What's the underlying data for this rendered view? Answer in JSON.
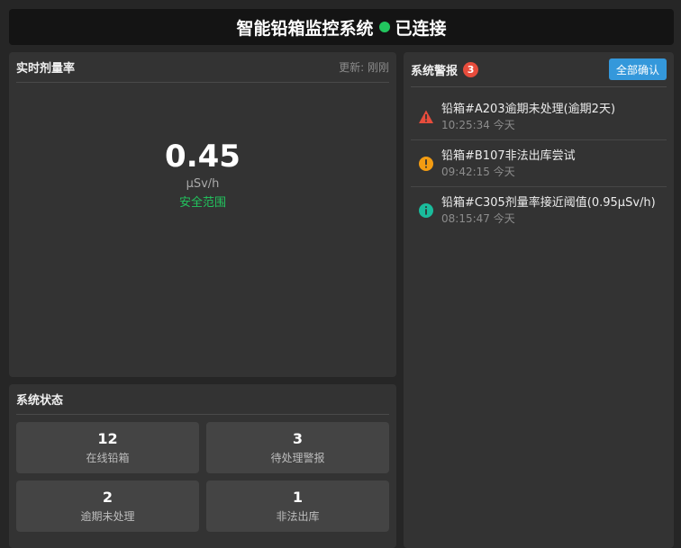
{
  "header": {
    "title": "智能铅箱监控系统",
    "connection_status": "已连接",
    "connection_color": "#22c55e"
  },
  "dose": {
    "title": "实时剂量率",
    "update_text": "更新: 刚刚",
    "value": "0.45",
    "unit": "μSv/h",
    "state": "安全范围",
    "state_color": "#22c55e"
  },
  "system_status": {
    "title": "系统状态",
    "cards": [
      {
        "value": "12",
        "label": "在线铅箱"
      },
      {
        "value": "3",
        "label": "待处理警报"
      },
      {
        "value": "2",
        "label": "逾期未处理"
      },
      {
        "value": "1",
        "label": "非法出库"
      }
    ]
  },
  "alerts": {
    "title": "系统警报",
    "badge_count": "3",
    "ack_all_label": "全部确认",
    "items": [
      {
        "icon": "warning-triangle-icon",
        "color": "#e74c3c",
        "message": "铅箱#A203逾期未处理(逾期2天)",
        "time": "10:25:34 今天"
      },
      {
        "icon": "exclamation-circle-icon",
        "color": "#f39c12",
        "message": "铅箱#B107非法出库尝试",
        "time": "09:42:15 今天"
      },
      {
        "icon": "info-circle-icon",
        "color": "#1abc9c",
        "message": "铅箱#C305剂量率接近阈值(0.95μSv/h)",
        "time": "08:15:47 今天"
      }
    ]
  }
}
